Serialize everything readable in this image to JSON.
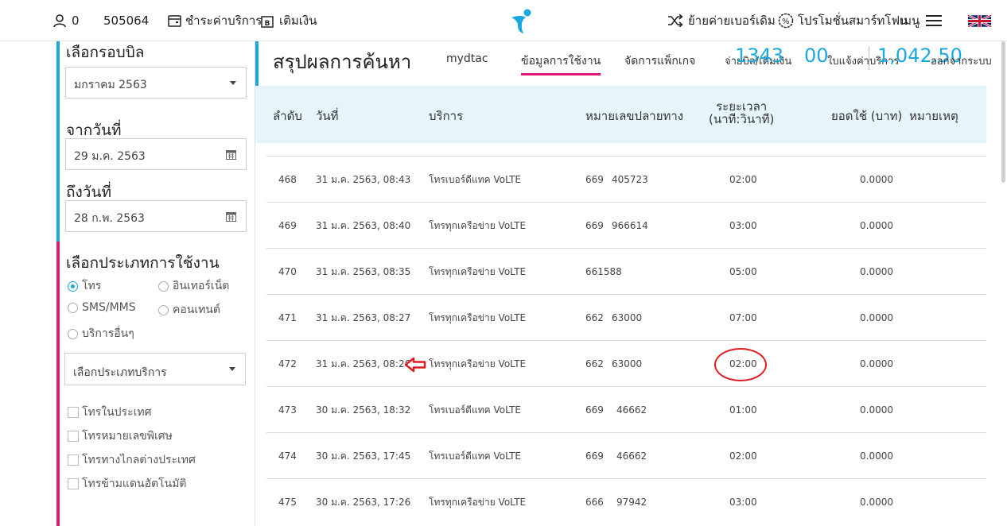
{
  "topnav": {
    "user_count": "0",
    "phone_number": "505064",
    "pay_label": "ชำระค่าบริการ",
    "topup_label": "เติมเงิน",
    "switch_label": "ย้ายค่ายเบอร์เดิม",
    "promo_label": "โปรโมชั่นสมาร์ทโฟน",
    "menu_label": "เมนู"
  },
  "sidebar": {
    "bill_cycle_label": "เลือกรอบบิล",
    "bill_cycle_value": "มกราคม 2563",
    "from_label": "จากวันที่",
    "from_value": "29 ม.ค. 2563",
    "to_label": "ถึงวันที่",
    "to_value": "28 ก.พ. 2563",
    "usage_type_label": "เลือกประเภทการใช้งาน",
    "usage_types": [
      "โทร",
      "อินเทอร์เน็ต",
      "SMS/MMS",
      "คอนเทนต์",
      "บริการอื่นๆ"
    ],
    "usage_selected": "โทร",
    "service_type_placeholder": "เลือกประเภทบริการ",
    "filters": [
      "โทรในประเทศ",
      "โทรหมายเลขพิเศษ",
      "โทรทางไกลต่างประเทศ",
      "โทรข้ามแดนอัตโนมัติ"
    ]
  },
  "main": {
    "title": "สรุปผลการค้นหา",
    "tabs": [
      "mydtac",
      "ข้อมูลการใช้งาน",
      "จัดการแพ็กเกจ"
    ],
    "active_tab": "ข้อมูลการใช้งาน",
    "overlap": {
      "balance_label": "จ่ายบิล/เติมเงิน",
      "number_a": "1343",
      "number_b": "00",
      "cycle_label": "ใบแจ้งค่าบริการ",
      "amount": "1,042.50",
      "logout_label": "ออกจากระบบ"
    }
  },
  "table": {
    "headers": {
      "index": "ลำดับ",
      "date": "วันที่",
      "service": "บริการ",
      "destination": "หมายเลขปลายทาง",
      "duration_line1": "ระยะเวลา",
      "duration_line2": "(นาที:วินาที)",
      "amount": "ยอดใช้ (บาท)",
      "note": "หมายเหตุ"
    },
    "rows": [
      {
        "index": "468",
        "date": "31 ม.ค. 2563, 08:43",
        "service": "โทรเบอร์ดีแทค VoLTE",
        "dest_a": "669",
        "dest_b": "405723",
        "duration": "02:00",
        "amount": "0.0000"
      },
      {
        "index": "469",
        "date": "31 ม.ค. 2563, 08:40",
        "service": "โทรทุกเครือข่าย VoLTE",
        "dest_a": "669",
        "dest_b": "966614",
        "duration": "03:00",
        "amount": "0.0000"
      },
      {
        "index": "470",
        "date": "31 ม.ค. 2563, 08:35",
        "service": "โทรทุกเครือข่าย VoLTE",
        "dest_a": "661588",
        "dest_b": "",
        "duration": "05:00",
        "amount": "0.0000"
      },
      {
        "index": "471",
        "date": "31 ม.ค. 2563, 08:27",
        "service": "โทรทุกเครือข่าย VoLTE",
        "dest_a": "662",
        "dest_b": "63000",
        "duration": "07:00",
        "amount": "0.0000"
      },
      {
        "index": "472",
        "date": "31 ม.ค. 2563, 08:26",
        "service": "โทรทุกเครือข่าย VoLTE",
        "dest_a": "662",
        "dest_b": "63000",
        "duration": "02:00",
        "amount": "0.0000"
      },
      {
        "index": "473",
        "date": "30 ม.ค. 2563, 18:32",
        "service": "โทรเบอร์ดีแทค VoLTE",
        "dest_a": "669",
        "dest_b": "46662",
        "duration": "01:00",
        "amount": "0.0000"
      },
      {
        "index": "474",
        "date": "30 ม.ค. 2563, 17:45",
        "service": "โทรเบอร์ดีแทค VoLTE",
        "dest_a": "669",
        "dest_b": "46662",
        "duration": "02:00",
        "amount": "0.0000"
      },
      {
        "index": "475",
        "date": "30 ม.ค. 2563, 17:26",
        "service": "โทรทุกเครือข่าย VoLTE",
        "dest_a": "666",
        "dest_b": "97942",
        "duration": "03:00",
        "amount": "0.0000"
      }
    ]
  },
  "colors": {
    "brand_blue": "#19a9e0",
    "accent_pink": "#e3167a",
    "annotation_red": "#e01c22",
    "header_bg": "#e6f4fb"
  },
  "icons": [
    "user-icon",
    "bill-icon",
    "topup-icon",
    "dtac-logo-icon",
    "shuffle-icon",
    "promo-badge-icon",
    "menu-icon",
    "uk-flag-icon",
    "calendar-icon",
    "chevron-down-icon"
  ]
}
